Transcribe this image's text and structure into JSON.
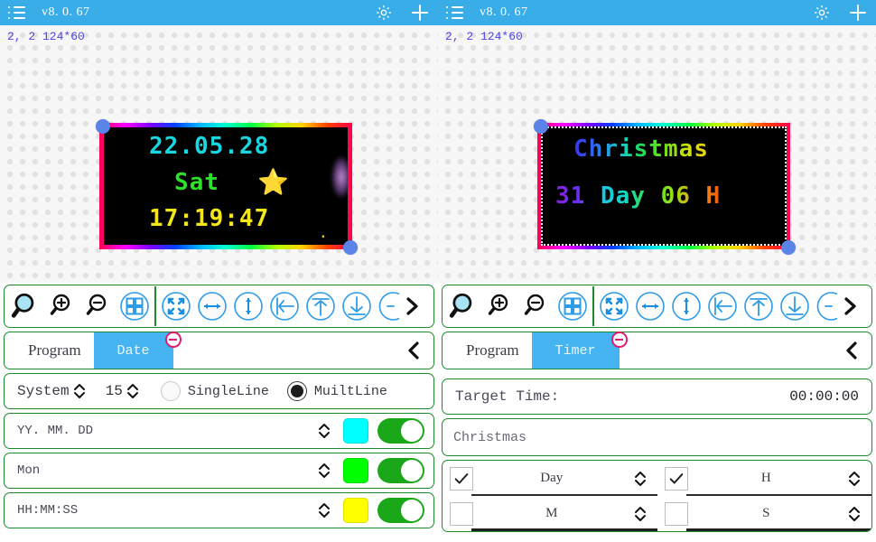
{
  "panels": [
    {
      "header": {
        "menu_icon": "hamburger-menu-icon",
        "version": "v8. 0. 67",
        "gear_icon": "gear-icon",
        "add_icon": "plus-icon"
      },
      "canvas": {
        "label": "2, 2  124*60",
        "display": {
          "lines": [
            {
              "text": "22.05.28",
              "color": "#19d7e0"
            },
            {
              "text": "Sat",
              "color": "#2ee028"
            },
            {
              "text": "17:19:47",
              "color": "#f2e61a"
            }
          ],
          "star_emoji": "⭐",
          "border_style": "rainbow"
        }
      },
      "toolbar": {
        "icons": [
          "magnifier-icon",
          "zoom-in-icon",
          "zoom-out-icon",
          "grid-layout-icon",
          "fullscreen-expand-icon",
          "align-horizontal-icon",
          "align-vertical-icon",
          "align-left-icon",
          "align-top-icon",
          "align-bottom-icon",
          "partial-circle-icon",
          "next-chevron-icon"
        ]
      },
      "tabs": {
        "program_label": "Program",
        "active_label": "Date",
        "remove_badge": "minus-circle-icon",
        "collapse_icon": "chevron-left-icon"
      },
      "system_row": {
        "label": "System",
        "value": "15",
        "options": [
          {
            "label": "SingleLine",
            "selected": false
          },
          {
            "label": "MuiltLine",
            "selected": true
          }
        ]
      },
      "format_rows": [
        {
          "label": "YY. MM. DD",
          "color": "#00FFFF",
          "enabled": true
        },
        {
          "label": "Mon",
          "color": "#00FF00",
          "enabled": true
        },
        {
          "label": "HH:MM:SS",
          "color": "#FFFF00",
          "enabled": true
        }
      ]
    },
    {
      "header": {
        "menu_icon": "hamburger-menu-icon",
        "version": "v8. 0. 67",
        "gear_icon": "gear-icon",
        "add_icon": "plus-icon"
      },
      "canvas": {
        "label": "2, 2  124*60",
        "display": {
          "lines": [
            {
              "text": "Christmas",
              "color": "rainbow"
            },
            {
              "text": "31 Day 06 H",
              "color": "rainbow"
            }
          ],
          "border_style": "rainbow-dotted"
        }
      },
      "toolbar": {
        "icons": [
          "magnifier-icon",
          "zoom-in-icon",
          "zoom-out-icon",
          "grid-layout-icon",
          "fullscreen-expand-icon",
          "align-horizontal-icon",
          "align-vertical-icon",
          "align-left-icon",
          "align-top-icon",
          "align-bottom-icon",
          "partial-circle-icon",
          "next-chevron-icon"
        ]
      },
      "tabs": {
        "program_label": "Program",
        "active_label": "Timer",
        "remove_badge": "minus-circle-icon",
        "collapse_icon": "chevron-left-icon"
      },
      "target_time": {
        "label": "Target Time:",
        "value": "00:00:00"
      },
      "text_field": {
        "value": "Christmas"
      },
      "unit_grid": [
        {
          "label": "Day",
          "checked": true
        },
        {
          "label": "H",
          "checked": true
        },
        {
          "label": "M",
          "checked": false
        },
        {
          "label": "S",
          "checked": false
        }
      ]
    }
  ],
  "theme": {
    "header_blue": "#39ade8",
    "tab_blue": "#45b4f0",
    "border_green": "#1e8a2e",
    "badge_pink": "#e8196e",
    "toggle_green": "#1aa81a",
    "label_violet": "#4e44e8"
  }
}
